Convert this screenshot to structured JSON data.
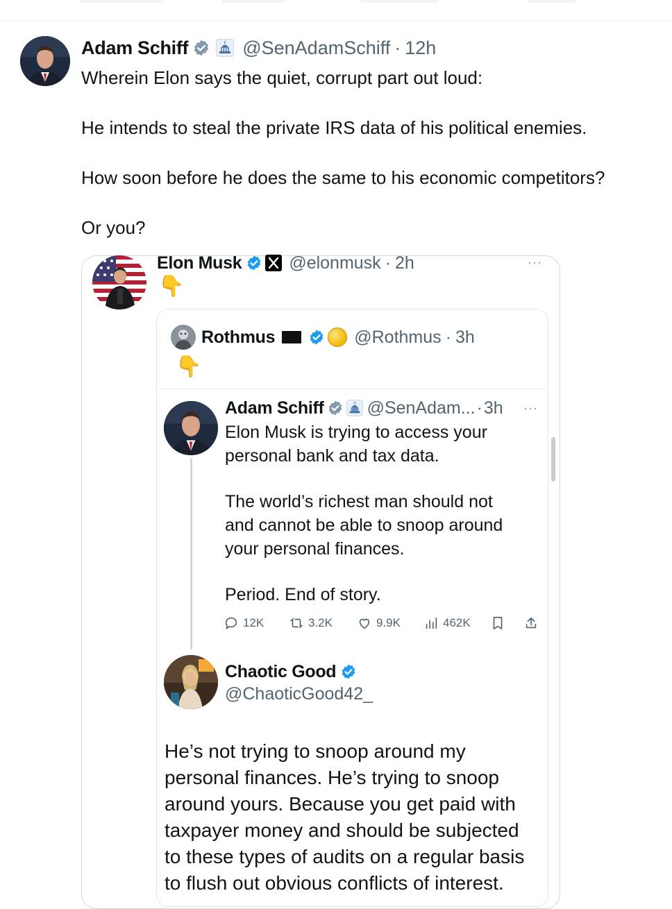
{
  "main_tweet": {
    "author_name": "Adam Schiff",
    "handle": "@SenAdamSchiff",
    "separator": "·",
    "time": "12h",
    "text_lines": [
      "Wherein Elon says the quiet, corrupt part out loud:",
      "He intends to steal the private IRS data of his political enemies.",
      "How soon before he does the same to his economic competitors?",
      "Or you?"
    ]
  },
  "quoted_tweet": {
    "author_name": "Elon Musk",
    "handle": "@elonmusk",
    "separator": "·",
    "time": "2h",
    "emoji": "👇",
    "more": "···"
  },
  "nested_quote": {
    "author_name": "Rothmus",
    "handle": "@Rothmus",
    "separator": "·",
    "time": "3h",
    "emoji": "👇"
  },
  "inner_tweet": {
    "author_name": "Adam Schiff",
    "handle": "@SenAdam...",
    "separator": "·",
    "time": "3h",
    "more": "···",
    "text_lines": [
      "Elon Musk is trying to access your",
      "personal bank and tax data.",
      "The world’s richest man should not",
      "and cannot be able to snoop around",
      "your personal finances.",
      "Period. End of story."
    ],
    "stats": {
      "replies": "12K",
      "reposts": "3.2K",
      "likes": "9.9K",
      "views": "462K"
    }
  },
  "reply_tweet": {
    "author_name": "Chaotic Good",
    "handle": "@ChaoticGood42_",
    "text_lines": [
      "He’s not trying to snoop around my",
      "personal finances.  He’s trying to snoop",
      "around yours. Because you get paid with",
      "taxpayer money and should be subjected",
      "to these types of audits on a regular basis",
      "to flush out obvious conflicts of interest."
    ]
  },
  "colors": {
    "verified_blue": "#1d9bf0",
    "verified_gray": "#829aab",
    "text_primary": "#0f1419",
    "text_secondary": "#536471",
    "border": "#cfd9de"
  },
  "icons": [
    "verified-gray-badge-icon",
    "capitol-flag-icon",
    "verified-blue-badge-icon",
    "x-logo-icon",
    "black-flag-icon",
    "gold-coin-icon",
    "reply-icon",
    "repost-icon",
    "like-icon",
    "views-icon",
    "bookmark-icon",
    "share-icon"
  ]
}
